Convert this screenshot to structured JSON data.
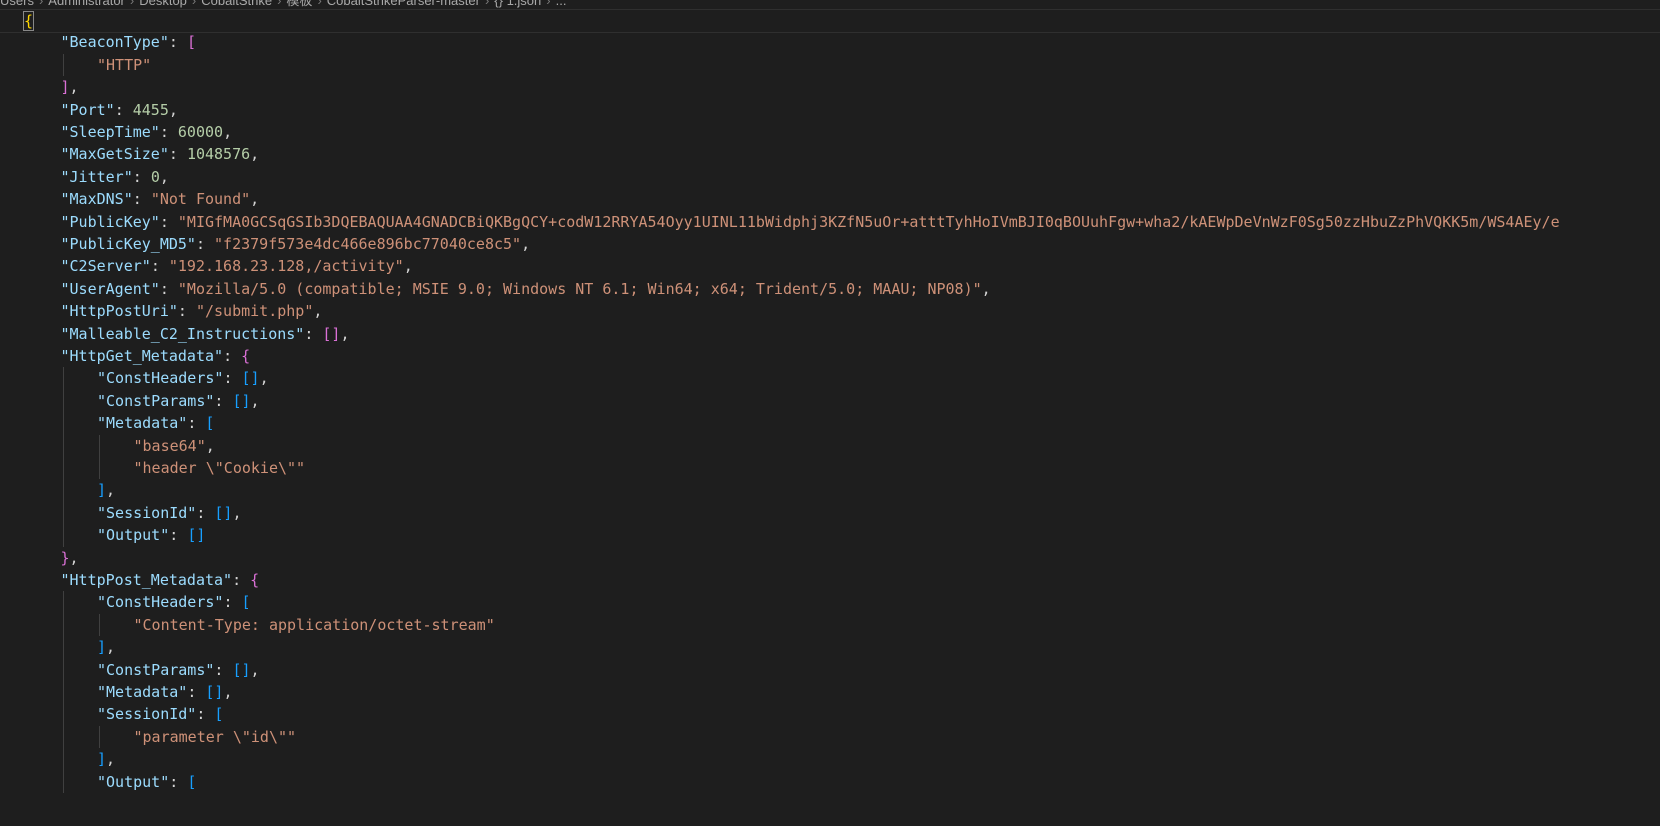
{
  "breadcrumb": [
    "Users",
    "Administrator",
    "Desktop",
    "CobaltStrike",
    "模板",
    "CobaltStrikeParser-master",
    "{} 1.json",
    "..."
  ],
  "lines": [
    [
      [
        "{",
        "b1"
      ]
    ],
    [
      [
        "\"BeaconType\"",
        "k"
      ],
      [
        ": ",
        "p"
      ],
      [
        "[",
        "b2"
      ]
    ],
    [
      [
        "\"HTTP\"",
        "s"
      ]
    ],
    [
      [
        "]",
        "b2"
      ],
      [
        ",",
        "p"
      ]
    ],
    [
      [
        "\"Port\"",
        "k"
      ],
      [
        ": ",
        "p"
      ],
      [
        "4455",
        "n"
      ],
      [
        ",",
        "p"
      ]
    ],
    [
      [
        "\"SleepTime\"",
        "k"
      ],
      [
        ": ",
        "p"
      ],
      [
        "60000",
        "n"
      ],
      [
        ",",
        "p"
      ]
    ],
    [
      [
        "\"MaxGetSize\"",
        "k"
      ],
      [
        ": ",
        "p"
      ],
      [
        "1048576",
        "n"
      ],
      [
        ",",
        "p"
      ]
    ],
    [
      [
        "\"Jitter\"",
        "k"
      ],
      [
        ": ",
        "p"
      ],
      [
        "0",
        "n"
      ],
      [
        ",",
        "p"
      ]
    ],
    [
      [
        "\"MaxDNS\"",
        "k"
      ],
      [
        ": ",
        "p"
      ],
      [
        "\"Not Found\"",
        "s"
      ],
      [
        ",",
        "p"
      ]
    ],
    [
      [
        "\"PublicKey\"",
        "k"
      ],
      [
        ": ",
        "p"
      ],
      [
        "\"MIGfMA0GCSqGSIb3DQEBAQUAA4GNADCBiQKBgQCY+codW12RRYA54Oyy1UINL11bWidphj3KZfN5uOr+atttTyhHoIVmBJI0qBOUuhFgw+wha2/kAEWpDeVnWzF0Sg50zzHbuZzPhVQKK5m/WS4AEy/e",
        "s"
      ]
    ],
    [
      [
        "\"PublicKey_MD5\"",
        "k"
      ],
      [
        ": ",
        "p"
      ],
      [
        "\"f2379f573e4dc466e896bc77040ce8c5\"",
        "s"
      ],
      [
        ",",
        "p"
      ]
    ],
    [
      [
        "\"C2Server\"",
        "k"
      ],
      [
        ": ",
        "p"
      ],
      [
        "\"192.168.23.128,/activity\"",
        "s"
      ],
      [
        ",",
        "p"
      ]
    ],
    [
      [
        "\"UserAgent\"",
        "k"
      ],
      [
        ": ",
        "p"
      ],
      [
        "\"Mozilla/5.0 (compatible; MSIE 9.0; Windows NT 6.1; Win64; x64; Trident/5.0; MAAU; NP08)\"",
        "s"
      ],
      [
        ",",
        "p"
      ]
    ],
    [
      [
        "\"HttpPostUri\"",
        "k"
      ],
      [
        ": ",
        "p"
      ],
      [
        "\"/submit.php\"",
        "s"
      ],
      [
        ",",
        "p"
      ]
    ],
    [
      [
        "\"Malleable_C2_Instructions\"",
        "k"
      ],
      [
        ": ",
        "p"
      ],
      [
        "[]",
        "b2"
      ],
      [
        ",",
        "p"
      ]
    ],
    [
      [
        "\"HttpGet_Metadata\"",
        "k"
      ],
      [
        ": ",
        "p"
      ],
      [
        "{",
        "b2"
      ]
    ],
    [
      [
        "\"ConstHeaders\"",
        "k"
      ],
      [
        ": ",
        "p"
      ],
      [
        "[]",
        "b3"
      ],
      [
        ",",
        "p"
      ]
    ],
    [
      [
        "\"ConstParams\"",
        "k"
      ],
      [
        ": ",
        "p"
      ],
      [
        "[]",
        "b3"
      ],
      [
        ",",
        "p"
      ]
    ],
    [
      [
        "\"Metadata\"",
        "k"
      ],
      [
        ": ",
        "p"
      ],
      [
        "[",
        "b3"
      ]
    ],
    [
      [
        "\"base64\"",
        "s"
      ],
      [
        ",",
        "p"
      ]
    ],
    [
      [
        "\"header \\\"Cookie\\\"\"",
        "s"
      ]
    ],
    [
      [
        "]",
        "b3"
      ],
      [
        ",",
        "p"
      ]
    ],
    [
      [
        "\"SessionId\"",
        "k"
      ],
      [
        ": ",
        "p"
      ],
      [
        "[]",
        "b3"
      ],
      [
        ",",
        "p"
      ]
    ],
    [
      [
        "\"Output\"",
        "k"
      ],
      [
        ": ",
        "p"
      ],
      [
        "[]",
        "b3"
      ]
    ],
    [
      [
        "}",
        "b2"
      ],
      [
        ",",
        "p"
      ]
    ],
    [
      [
        "\"HttpPost_Metadata\"",
        "k"
      ],
      [
        ": ",
        "p"
      ],
      [
        "{",
        "b2"
      ]
    ],
    [
      [
        "\"ConstHeaders\"",
        "k"
      ],
      [
        ": ",
        "p"
      ],
      [
        "[",
        "b3"
      ]
    ],
    [
      [
        "\"Content-Type: application/octet-stream\"",
        "s"
      ]
    ],
    [
      [
        "]",
        "b3"
      ],
      [
        ",",
        "p"
      ]
    ],
    [
      [
        "\"ConstParams\"",
        "k"
      ],
      [
        ": ",
        "p"
      ],
      [
        "[]",
        "b3"
      ],
      [
        ",",
        "p"
      ]
    ],
    [
      [
        "\"Metadata\"",
        "k"
      ],
      [
        ": ",
        "p"
      ],
      [
        "[]",
        "b3"
      ],
      [
        ",",
        "p"
      ]
    ],
    [
      [
        "\"SessionId\"",
        "k"
      ],
      [
        ": ",
        "p"
      ],
      [
        "[",
        "b3"
      ]
    ],
    [
      [
        "\"parameter \\\"id\\\"\"",
        "s"
      ]
    ],
    [
      [
        "]",
        "b3"
      ],
      [
        ",",
        "p"
      ]
    ],
    [
      [
        "\"Output\"",
        "k"
      ],
      [
        ": ",
        "p"
      ],
      [
        "[",
        "b3"
      ]
    ]
  ],
  "colors": {
    "background": "#1e1e1e",
    "key": "#9cdcfe",
    "string": "#ce9178",
    "number": "#b5cea8",
    "bracket_level1": "#ffd700",
    "bracket_level2": "#da70d6",
    "bracket_level3": "#179fff"
  }
}
